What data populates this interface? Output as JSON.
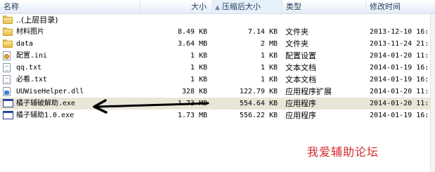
{
  "columns": {
    "name": "名称",
    "size": "大小",
    "compressed": "压缩后大小",
    "type": "类型",
    "modified": "修改时间"
  },
  "files": [
    {
      "name": "..(上层目录)",
      "size": "",
      "compressed": "",
      "type": "",
      "modified": "",
      "icon": "up-folder-icon"
    },
    {
      "name": "材料图片",
      "size": "8.49 KB",
      "compressed": "7.14 KB",
      "type": "文件夹",
      "modified": "2013-12-10 16:",
      "icon": "folder-icon"
    },
    {
      "name": "data",
      "size": "3.64 MB",
      "compressed": "2 MB",
      "type": "文件夹",
      "modified": "2013-11-24 21:",
      "icon": "folder-icon"
    },
    {
      "name": "配置.ini",
      "size": "1 KB",
      "compressed": "1 KB",
      "type": "配置设置",
      "modified": "2014-01-20 11:",
      "icon": "settings-file-icon"
    },
    {
      "name": "qq.txt",
      "size": "1 KB",
      "compressed": "1 KB",
      "type": "文本文档",
      "modified": "2014-01-19 16:",
      "icon": "text-file-icon"
    },
    {
      "name": "必看.txt",
      "size": "1 KB",
      "compressed": "1 KB",
      "type": "文本文档",
      "modified": "2014-01-19 16:",
      "icon": "text-file-icon"
    },
    {
      "name": "UUWiseHelper.dll",
      "size": "328 KB",
      "compressed": "122.79 KB",
      "type": "应用程序扩展",
      "modified": "2014-01-20 11:",
      "icon": "dll-file-icon"
    },
    {
      "name": "橘子辅破解助.exe",
      "size": "1.73 MB",
      "compressed": "554.64 KB",
      "type": "应用程序",
      "modified": "2014-01-20 11:",
      "icon": "exe-file-icon",
      "selected": true
    },
    {
      "name": "橘子辅助1.0.exe",
      "size": "1.73 MB",
      "compressed": "556.22 KB",
      "type": "应用程序",
      "modified": "2014-01-19 16:",
      "icon": "exe-file-icon"
    }
  ],
  "watermark": "我爱辅助论坛",
  "colors": {
    "selection": "#e9e6d8",
    "header_text": "#1e395b",
    "watermark": "#d42a2a",
    "annotation_arrow": "#000000"
  }
}
